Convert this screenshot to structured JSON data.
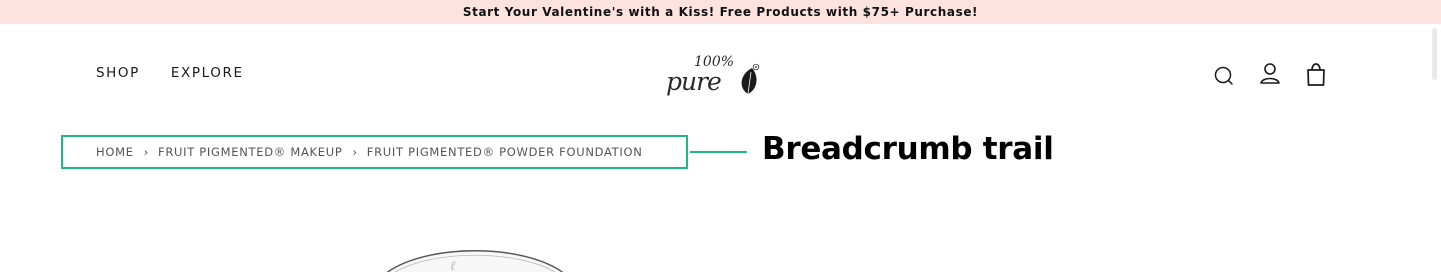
{
  "promo": {
    "text": "Start Your Valentine's with a Kiss! Free Products with $75+ Purchase!"
  },
  "nav": {
    "left": [
      {
        "label": "SHOP"
      },
      {
        "label": "EXPLORE"
      }
    ],
    "icons": [
      "search-icon",
      "account-icon",
      "shopping-bag-icon"
    ]
  },
  "logo": {
    "line1": "100%",
    "line2": "pure"
  },
  "breadcrumb": {
    "items": [
      "HOME",
      "FRUIT PIGMENTED® MAKEUP",
      "FRUIT PIGMENTED® POWDER FOUNDATION"
    ],
    "separator": "›"
  },
  "annotation": {
    "label": "Breadcrumb trail",
    "color": "#1fb785"
  },
  "colors": {
    "promo_bg": "#fce3df",
    "text": "#1a1a1a",
    "breadcrumb_text": "#555555"
  }
}
